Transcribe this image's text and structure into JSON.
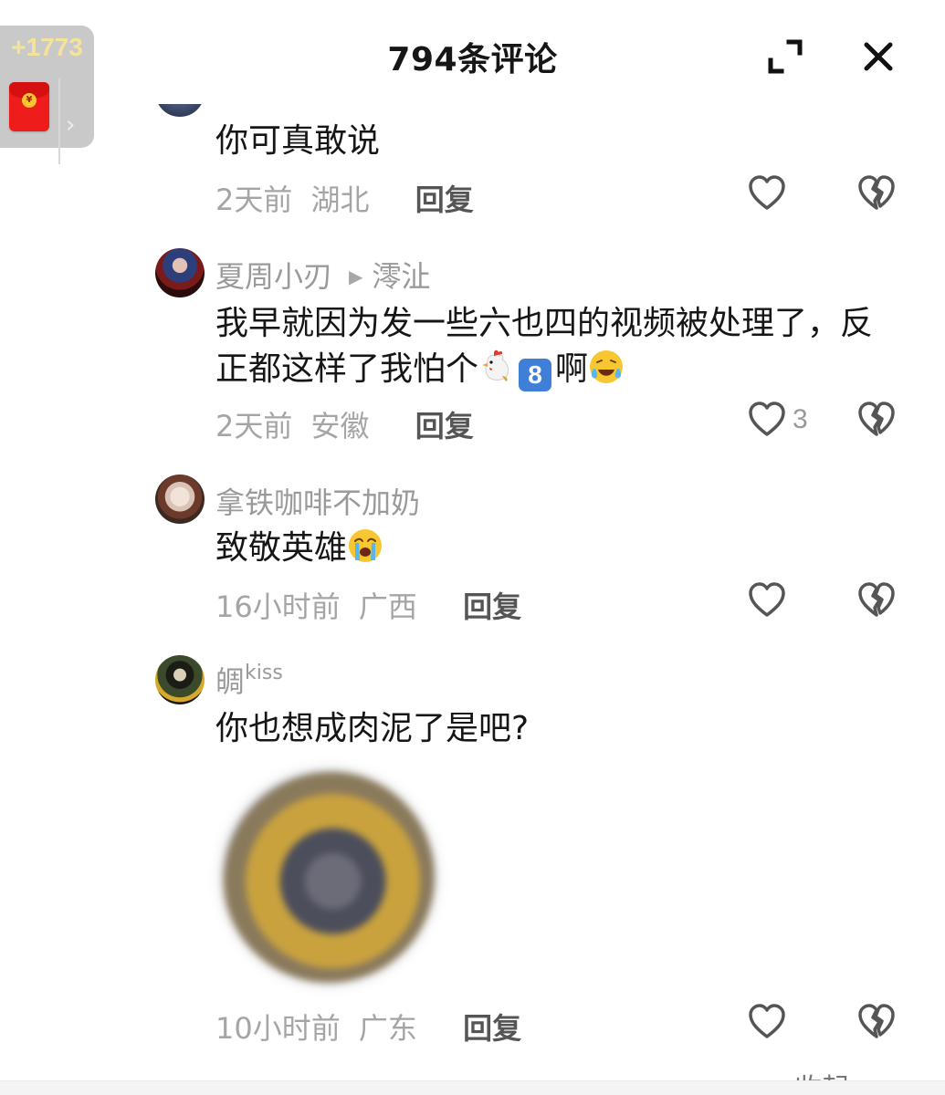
{
  "header": {
    "title": "794条评论",
    "expand_icon": "expand-icon",
    "close_icon": "close-icon"
  },
  "red_packet": {
    "count": "+1773",
    "icon": "red-envelope-icon",
    "chevron": "›"
  },
  "comments": [
    {
      "username": "",
      "content": "你可真敢说",
      "time": "2天前",
      "location": "湖北",
      "reply_label": "回复",
      "like_count": ""
    },
    {
      "username": "夏周小刃",
      "reply_to": "澪沚",
      "content_part1": "我早就因为发一些六也四的视频被处理了，反正都这样了我怕个",
      "content_emoji_digit": "8",
      "content_part2": "啊",
      "time": "2天前",
      "location": "安徽",
      "reply_label": "回复",
      "like_count": "3"
    },
    {
      "username": "拿铁咖啡不加奶",
      "content": "致敬英雄",
      "time": "16小时前",
      "location": "广西",
      "reply_label": "回复",
      "like_count": ""
    },
    {
      "username": "皗",
      "username_sup": "kiss",
      "content": "你也想成肉泥了是吧?",
      "time": "10小时前",
      "location": "广东",
      "reply_label": "回复",
      "like_count": ""
    }
  ],
  "footer": {
    "collapse_label": "收起"
  },
  "colors": {
    "accent_red": "#ef1c1c",
    "count_gold": "#f6e39b",
    "text_primary": "#161616",
    "text_secondary": "#a5a5a5"
  }
}
